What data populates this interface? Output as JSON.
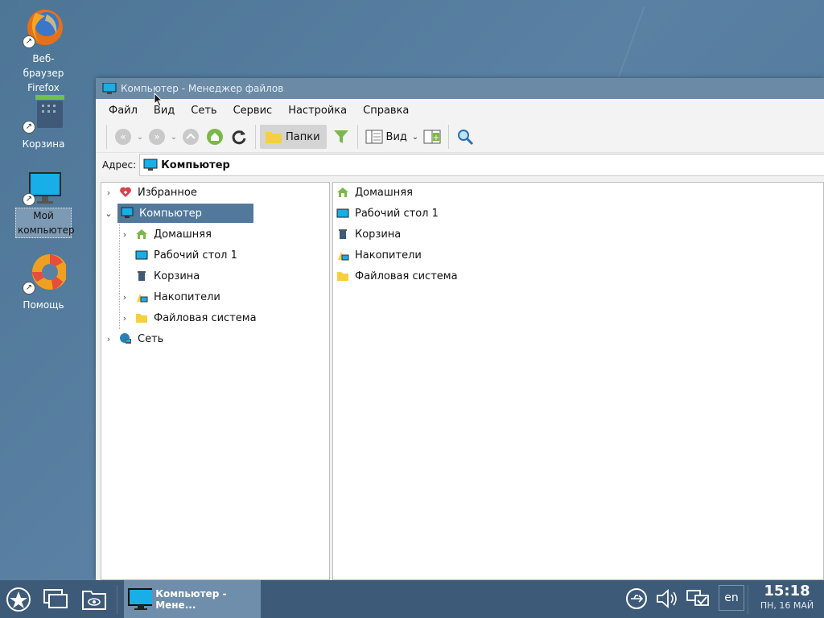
{
  "desktop": {
    "icons": [
      {
        "label": "Веб-браузер Firefox"
      },
      {
        "label": "Корзина"
      },
      {
        "label": "Мой компьютер"
      },
      {
        "label": "Помощь"
      }
    ]
  },
  "window": {
    "title": "Компьютер - Менеджер файлов",
    "menu": [
      "Файл",
      "Вид",
      "Сеть",
      "Сервис",
      "Настройка",
      "Справка"
    ],
    "toolbar": {
      "folders_label": "Папки",
      "view_label": "Вид"
    },
    "address": {
      "label": "Адрес:",
      "value": "Компьютер"
    },
    "tree": [
      {
        "label": "Избранное"
      },
      {
        "label": "Компьютер"
      },
      {
        "label": "Домашняя"
      },
      {
        "label": "Рабочий стол 1"
      },
      {
        "label": "Корзина"
      },
      {
        "label": "Накопители"
      },
      {
        "label": "Файловая система"
      },
      {
        "label": "Сеть"
      }
    ],
    "items": [
      {
        "label": "Домашняя"
      },
      {
        "label": "Рабочий стол 1"
      },
      {
        "label": "Корзина"
      },
      {
        "label": "Накопители"
      },
      {
        "label": "Файловая система"
      }
    ]
  },
  "taskbar": {
    "task_label": "Компьютер - Мене...",
    "lang": "en",
    "time": "15:18",
    "date": "ПН, 16 МАЙ"
  },
  "colors": {
    "desktop_bg": "#5a81a3",
    "titlebar": "#6a8aa6",
    "selection": "#52789b",
    "taskbar": "#3d5a78",
    "active_task": "#6e8eab"
  }
}
